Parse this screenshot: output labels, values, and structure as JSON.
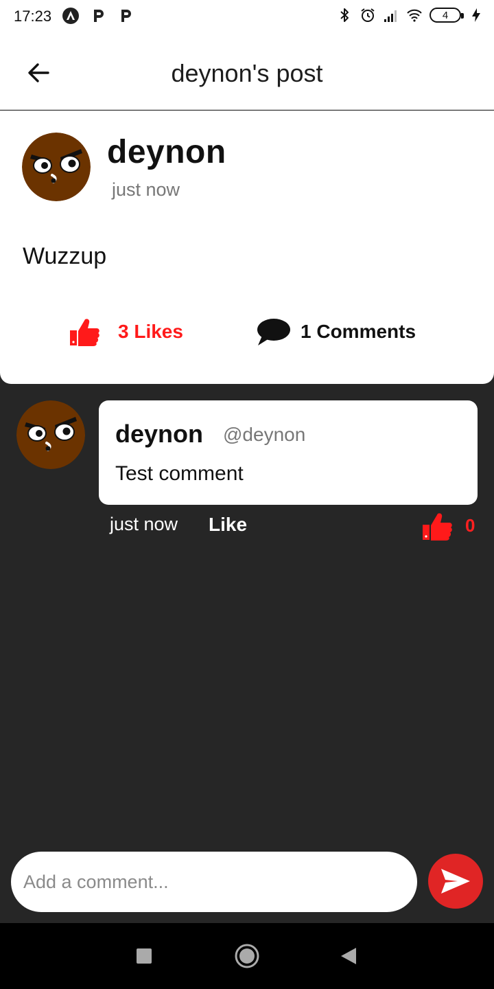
{
  "status_bar": {
    "time": "17:23",
    "notification_icons": [
      "app-icon",
      "parking-icon",
      "parking-icon"
    ],
    "right_icons": [
      "bluetooth-icon",
      "alarm-icon",
      "signal-icon",
      "wifi-icon"
    ],
    "battery_level": "4"
  },
  "header": {
    "title": "deynon's post"
  },
  "post": {
    "author": "deynon",
    "time": "just now",
    "body": "Wuzzup",
    "likes_label": "3 Likes",
    "comments_label": "1 Comments"
  },
  "comments": [
    {
      "author": "deynon",
      "handle": "@deynon",
      "text": "Test comment",
      "time": "just now",
      "like_label": "Like",
      "like_count": "0"
    }
  ],
  "composer": {
    "placeholder": "Add a comment..."
  },
  "colors": {
    "accent": "#ff1a1a",
    "send_button": "#e02525",
    "avatar": "#6b3300",
    "background": "#262626"
  }
}
